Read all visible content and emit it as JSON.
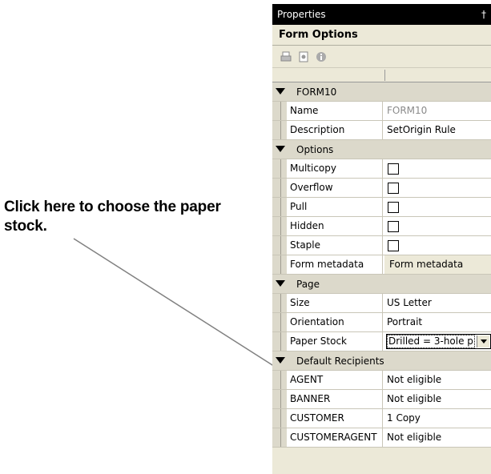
{
  "callout": {
    "line1": "Click here to choose the paper",
    "line2": "stock."
  },
  "panel": {
    "title": "Properties",
    "pin_glyph": "†",
    "header": "Form Options",
    "toolbar": [
      "print-icon",
      "page-icon",
      "info-icon"
    ],
    "categories": [
      {
        "label": "FORM10",
        "rows": [
          {
            "name": "Name",
            "value": "FORM10",
            "kind": "readonly"
          },
          {
            "name": "Description",
            "value": "SetOrigin Rule",
            "kind": "text"
          }
        ]
      },
      {
        "label": "Options",
        "rows": [
          {
            "name": "Multicopy",
            "kind": "checkbox",
            "checked": false
          },
          {
            "name": "Overflow",
            "kind": "checkbox",
            "checked": false
          },
          {
            "name": "Pull",
            "kind": "checkbox",
            "checked": false
          },
          {
            "name": "Hidden",
            "kind": "checkbox",
            "checked": false
          },
          {
            "name": "Staple",
            "kind": "checkbox",
            "checked": false
          },
          {
            "name": "Form metadata",
            "value": "Form metadata",
            "kind": "button"
          }
        ]
      },
      {
        "label": "Page",
        "rows": [
          {
            "name": "Size",
            "value": "US Letter",
            "kind": "text"
          },
          {
            "name": "Orientation",
            "value": "Portrait",
            "kind": "text"
          },
          {
            "name": "Paper Stock",
            "value": "Drilled = 3-hole p",
            "kind": "select"
          }
        ]
      },
      {
        "label": "Default Recipients",
        "rows": [
          {
            "name": "AGENT",
            "value": "Not eligible",
            "kind": "text"
          },
          {
            "name": "BANNER",
            "value": "Not eligible",
            "kind": "text"
          },
          {
            "name": "CUSTOMER",
            "value": "1 Copy",
            "kind": "text"
          },
          {
            "name": "CUSTOMERAGENT",
            "value": "Not eligible",
            "kind": "text"
          }
        ]
      }
    ]
  }
}
